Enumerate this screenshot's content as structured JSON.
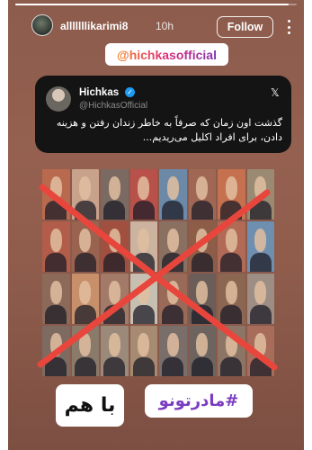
{
  "story": {
    "progress": 0.97,
    "username": "alllllllikarimi8",
    "time": "10h",
    "follow_label": "Follow"
  },
  "mention_sticker": "@hichkasofficial",
  "tweet": {
    "name": "Hichkas",
    "handle": "@HichkasOfficial",
    "text": "گذشت اون زمان که صرفاً به خاطر زندان رفتن و هزینه دادن، برای افراد اکلیل می‌ریدیم...",
    "platform_icon": "x-logo-icon"
  },
  "photo_grid": {
    "rows": 4,
    "columns": 8,
    "cell_colors": [
      "#b96a4e",
      "#c9a28c",
      "#7b6a62",
      "#b8514a",
      "#6c8aa8",
      "#a06854",
      "#c5704e",
      "#9b8a72",
      "#b25d4a",
      "#9a6350",
      "#a14f3f",
      "#cbb3a0",
      "#8a7061",
      "#8d5d47",
      "#b06a55",
      "#6f8fb0",
      "#8c6a5a",
      "#c78f6a",
      "#a37a68",
      "#c7bfb2",
      "#9a6a58",
      "#6b5d57",
      "#8b6651",
      "#9c8d85",
      "#7d6b61",
      "#8a7a6a",
      "#9b8a7a",
      "#a68a72",
      "#7a6e6a",
      "#6d6460",
      "#8d7565",
      "#a86c5a"
    ],
    "overlay": "red-x-cross"
  },
  "sticker_left": "با هم",
  "sticker_right": "#مادرتونو",
  "colors": {
    "cross": "#e8463c",
    "background": "#8c5c4d",
    "tweet_card": "#141414",
    "verified": "#1d9bf0"
  }
}
